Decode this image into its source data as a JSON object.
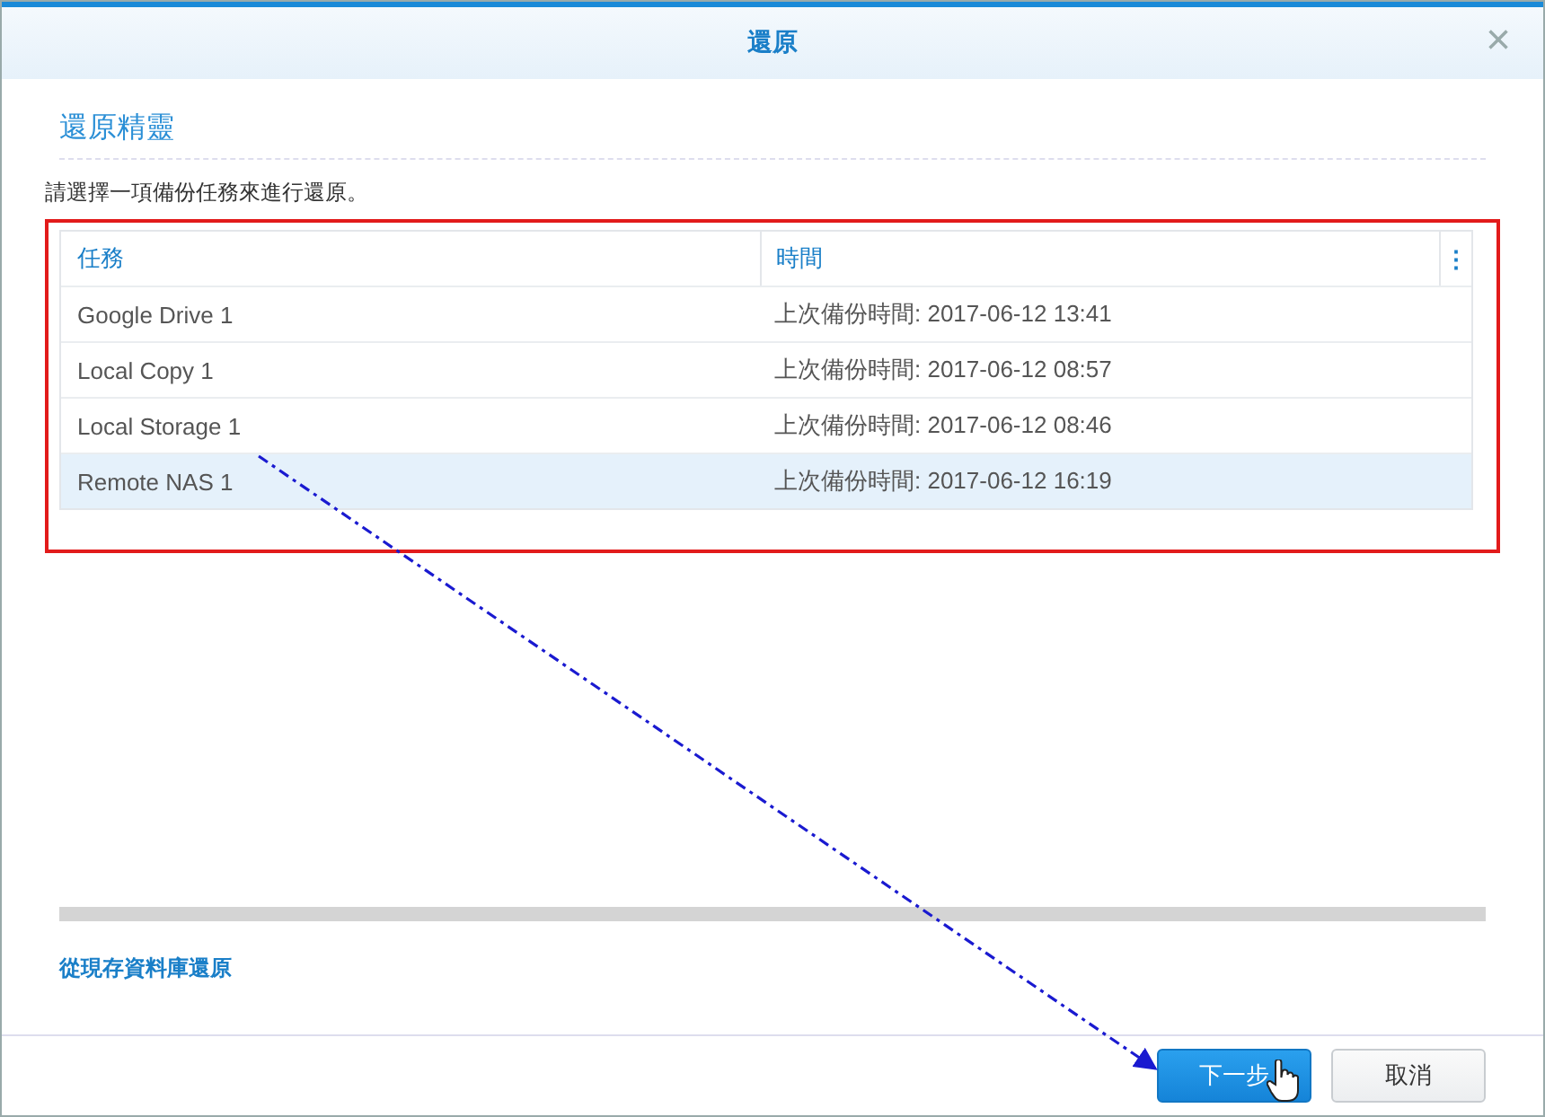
{
  "window": {
    "title": "還原",
    "close": "×"
  },
  "wizard": {
    "title": "還原精靈",
    "instruction": "請選擇一項備份任務來進行還原。"
  },
  "table": {
    "columns": [
      "任務",
      "時間"
    ],
    "menu": "⋮",
    "rows": [
      {
        "task": "Google Drive 1",
        "time": "上次備份時間: 2017-06-12 13:41",
        "selected": false
      },
      {
        "task": "Local Copy 1",
        "time": "上次備份時間: 2017-06-12 08:57",
        "selected": false
      },
      {
        "task": "Local Storage 1",
        "time": "上次備份時間: 2017-06-12 08:46",
        "selected": false
      },
      {
        "task": "Remote NAS 1",
        "time": "上次備份時間: 2017-06-12 16:19",
        "selected": true
      }
    ]
  },
  "link": "從現存資料庫還原",
  "buttons": [
    {
      "label": "下一步",
      "kind": "primary"
    },
    {
      "label": "取消",
      "kind": "secondary"
    }
  ]
}
